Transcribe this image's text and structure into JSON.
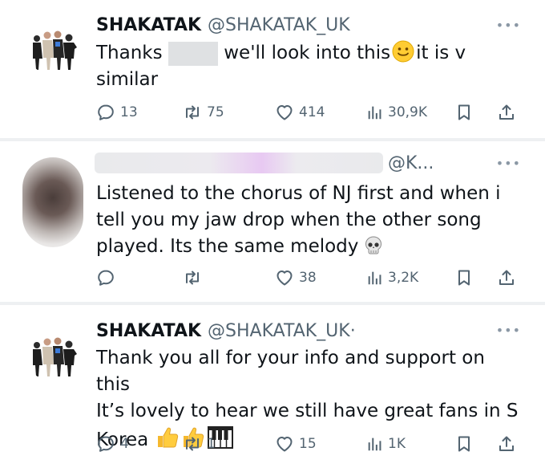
{
  "tweets": [
    {
      "name": "SHAKATAK",
      "handle": "@SHAKATAK_UK",
      "text_before": "Thanks",
      "text_middle": "we'll look into this",
      "text_after": "it is v",
      "text_line2": "similar",
      "replies": "13",
      "retweets": "75",
      "likes": "414",
      "views": "30,9K",
      "more_icon": "more-dots-icon"
    },
    {
      "handle": "@K...",
      "lines": [
        "Listened to the chorus of NJ first and when i",
        "tell you my jaw drop when the other song",
        "played. Its the same melody"
      ],
      "replies": "",
      "retweets": "",
      "likes": "38",
      "views": "3,2K"
    },
    {
      "name": "SHAKATAK",
      "handle": "@SHAKATAK_UK·",
      "lines": [
        "Thank you all for your info and support on this",
        "It’s lovely to hear we still have great fans in S",
        "Korea"
      ],
      "replies": "4",
      "retweets": "1",
      "likes": "15",
      "views": "1K"
    }
  ],
  "icons": {
    "reply": "reply-bubble-icon",
    "retweet": "retweet-icon",
    "like": "heart-icon",
    "views": "views-bar-chart-icon",
    "bookmark": "bookmark-icon",
    "share": "share-upload-icon"
  },
  "colors": {
    "text": "#0f1419",
    "secondary": "#536471",
    "separator": "#eef0f2"
  }
}
